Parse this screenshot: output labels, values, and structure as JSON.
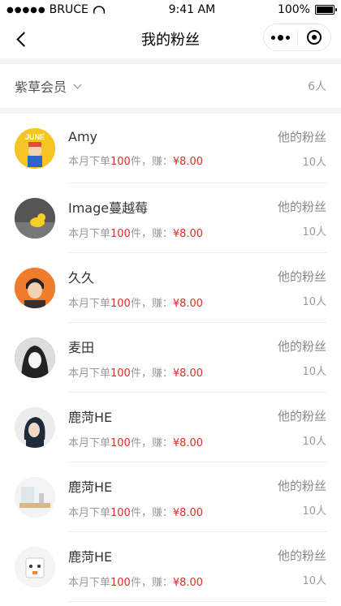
{
  "status_bar": {
    "carrier": "BRUCE",
    "time": "9:41 AM",
    "battery": "100%"
  },
  "nav": {
    "title": "我的粉丝"
  },
  "filter": {
    "label": "紫草会员",
    "count": "6人"
  },
  "fans": [
    {
      "name": "Amy",
      "prefix": "本月下单",
      "orders": "100",
      "suffix": "件，赚：",
      "money": "¥8.00",
      "link": "他的粉丝",
      "fans_count": "10人",
      "avatar": "yellow"
    },
    {
      "name": "Image蔓越莓",
      "prefix": "本月下单",
      "orders": "100",
      "suffix": "件，赚：",
      "money": "¥8.00",
      "link": "他的粉丝",
      "fans_count": "10人",
      "avatar": "gray"
    },
    {
      "name": "久久",
      "prefix": "本月下单",
      "orders": "100",
      "suffix": "件，赚：",
      "money": "¥8.00",
      "link": "他的粉丝",
      "fans_count": "10人",
      "avatar": "orange"
    },
    {
      "name": "麦田",
      "prefix": "本月下单",
      "orders": "100",
      "suffix": "件，赚：",
      "money": "¥8.00",
      "link": "他的粉丝",
      "fans_count": "10人",
      "avatar": "gray"
    },
    {
      "name": "鹿菏HE",
      "prefix": "本月下单",
      "orders": "100",
      "suffix": "件，赚：",
      "money": "¥8.00",
      "link": "他的粉丝",
      "fans_count": "10人",
      "avatar": "light"
    },
    {
      "name": "鹿菏HE",
      "prefix": "本月下单",
      "orders": "100",
      "suffix": "件，赚：",
      "money": "¥8.00",
      "link": "他的粉丝",
      "fans_count": "10人",
      "avatar": "light"
    },
    {
      "name": "鹿菏HE",
      "prefix": "本月下单",
      "orders": "100",
      "suffix": "件，赚：",
      "money": "¥8.00",
      "link": "他的粉丝",
      "fans_count": "10人",
      "avatar": "lighter"
    }
  ],
  "icons": {
    "back": "chevron-left-icon",
    "more": "more-dots-icon",
    "home": "target-icon",
    "dropdown": "chevron-down-icon"
  },
  "colors": {
    "accent": "#e02e24",
    "divider": "#eeeeee"
  }
}
